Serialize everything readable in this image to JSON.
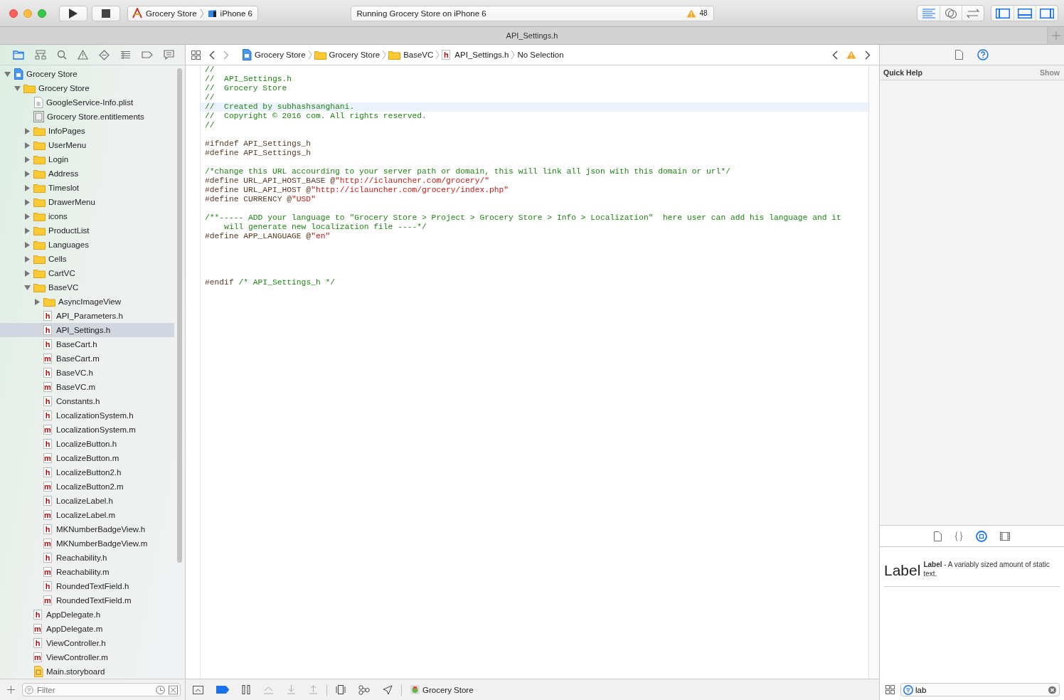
{
  "toolbar": {
    "scheme": "Grocery Store",
    "destination": "iPhone 6",
    "status": "Running Grocery Store on iPhone 6",
    "warning_count": "48",
    "editor_modes": [
      {
        "kind": "standard",
        "selected": true
      },
      {
        "kind": "assistant",
        "selected": false
      },
      {
        "kind": "version",
        "selected": false
      }
    ],
    "panels": [
      {
        "kind": "left",
        "on": true
      },
      {
        "kind": "bottom",
        "on": true
      },
      {
        "kind": "right",
        "on": true
      }
    ]
  },
  "tab_bar": {
    "title": "API_Settings.h"
  },
  "navigator": {
    "tabs": [
      {
        "kind": "project",
        "selected": true
      },
      {
        "kind": "symbol",
        "selected": false
      },
      {
        "kind": "find",
        "selected": false
      },
      {
        "kind": "issue",
        "selected": false
      },
      {
        "kind": "test",
        "selected": false
      },
      {
        "kind": "debug",
        "selected": false
      },
      {
        "kind": "breakpoint",
        "selected": false
      },
      {
        "kind": "report",
        "selected": false
      }
    ],
    "tree": [
      {
        "name": "Grocery Store",
        "kind": "project",
        "expanded": true,
        "selected": false,
        "children": [
          {
            "name": "Grocery Store",
            "kind": "folder",
            "expanded": true,
            "selected": false,
            "children": [
              {
                "name": "GoogleService-Info.plist",
                "kind": "plist",
                "selected": false
              },
              {
                "name": "Grocery Store.entitlements",
                "kind": "entitlements",
                "selected": false
              },
              {
                "name": "InfoPages",
                "kind": "folder",
                "expanded": false,
                "selected": false
              },
              {
                "name": "UserMenu",
                "kind": "folder",
                "expanded": false,
                "selected": false
              },
              {
                "name": "Login",
                "kind": "folder",
                "expanded": false,
                "selected": false
              },
              {
                "name": "Address",
                "kind": "folder",
                "expanded": false,
                "selected": false
              },
              {
                "name": "Timeslot",
                "kind": "folder",
                "expanded": false,
                "selected": false
              },
              {
                "name": "DrawerMenu",
                "kind": "folder",
                "expanded": false,
                "selected": false
              },
              {
                "name": "icons",
                "kind": "folder",
                "expanded": false,
                "selected": false
              },
              {
                "name": "ProductList",
                "kind": "folder",
                "expanded": false,
                "selected": false
              },
              {
                "name": "Languages",
                "kind": "folder",
                "expanded": false,
                "selected": false
              },
              {
                "name": "Cells",
                "kind": "folder",
                "expanded": false,
                "selected": false
              },
              {
                "name": "CartVC",
                "kind": "folder",
                "expanded": false,
                "selected": false
              },
              {
                "name": "BaseVC",
                "kind": "folder",
                "expanded": true,
                "selected": false,
                "children": [
                  {
                    "name": "AsyncImageView",
                    "kind": "folder",
                    "expanded": false,
                    "selected": false
                  },
                  {
                    "name": "API_Parameters.h",
                    "kind": "file",
                    "letter": "h",
                    "selected": false
                  },
                  {
                    "name": "API_Settings.h",
                    "kind": "file",
                    "letter": "h",
                    "selected": true
                  },
                  {
                    "name": "BaseCart.h",
                    "kind": "file",
                    "letter": "h",
                    "selected": false
                  },
                  {
                    "name": "BaseCart.m",
                    "kind": "file",
                    "letter": "m",
                    "selected": false
                  },
                  {
                    "name": "BaseVC.h",
                    "kind": "file",
                    "letter": "h",
                    "selected": false
                  },
                  {
                    "name": "BaseVC.m",
                    "kind": "file",
                    "letter": "m",
                    "selected": false
                  },
                  {
                    "name": "Constants.h",
                    "kind": "file",
                    "letter": "h",
                    "selected": false
                  },
                  {
                    "name": "LocalizationSystem.h",
                    "kind": "file",
                    "letter": "h",
                    "selected": false
                  },
                  {
                    "name": "LocalizationSystem.m",
                    "kind": "file",
                    "letter": "m",
                    "selected": false
                  },
                  {
                    "name": "LocalizeButton.h",
                    "kind": "file",
                    "letter": "h",
                    "selected": false
                  },
                  {
                    "name": "LocalizeButton.m",
                    "kind": "file",
                    "letter": "m",
                    "selected": false
                  },
                  {
                    "name": "LocalizeButton2.h",
                    "kind": "file",
                    "letter": "h",
                    "selected": false
                  },
                  {
                    "name": "LocalizeButton2.m",
                    "kind": "file",
                    "letter": "m",
                    "selected": false
                  },
                  {
                    "name": "LocalizeLabel.h",
                    "kind": "file",
                    "letter": "h",
                    "selected": false
                  },
                  {
                    "name": "LocalizeLabel.m",
                    "kind": "file",
                    "letter": "m",
                    "selected": false
                  },
                  {
                    "name": "MKNumberBadgeView.h",
                    "kind": "file",
                    "letter": "h",
                    "selected": false
                  },
                  {
                    "name": "MKNumberBadgeView.m",
                    "kind": "file",
                    "letter": "m",
                    "selected": false
                  },
                  {
                    "name": "Reachability.h",
                    "kind": "file",
                    "letter": "h",
                    "selected": false
                  },
                  {
                    "name": "Reachability.m",
                    "kind": "file",
                    "letter": "m",
                    "selected": false
                  },
                  {
                    "name": "RoundedTextField.h",
                    "kind": "file",
                    "letter": "h",
                    "selected": false
                  },
                  {
                    "name": "RoundedTextField.m",
                    "kind": "file",
                    "letter": "m",
                    "selected": false
                  }
                ]
              },
              {
                "name": "AppDelegate.h",
                "kind": "file",
                "letter": "h",
                "selected": false
              },
              {
                "name": "AppDelegate.m",
                "kind": "file",
                "letter": "m",
                "selected": false
              },
              {
                "name": "ViewController.h",
                "kind": "file",
                "letter": "h",
                "selected": false
              },
              {
                "name": "ViewController.m",
                "kind": "file",
                "letter": "m",
                "selected": false
              },
              {
                "name": "Main.storyboard",
                "kind": "storyboard",
                "selected": false
              }
            ]
          }
        ]
      }
    ],
    "filter": {
      "placeholder": "Filter"
    }
  },
  "jump_bar": {
    "path": [
      {
        "label": "Grocery Store",
        "kind": "project"
      },
      {
        "label": "Grocery Store",
        "kind": "folder"
      },
      {
        "label": "BaseVC",
        "kind": "folder"
      },
      {
        "label": "API_Settings.h",
        "kind": "file",
        "letter": "h"
      },
      {
        "label": "No Selection"
      }
    ]
  },
  "editor": {
    "lines": [
      {
        "segments": [
          {
            "kind": "comment",
            "text": "//"
          }
        ]
      },
      {
        "segments": [
          {
            "kind": "comment",
            "text": "//  API_Settings.h"
          }
        ]
      },
      {
        "segments": [
          {
            "kind": "comment",
            "text": "//  Grocery Store"
          }
        ]
      },
      {
        "segments": [
          {
            "kind": "comment",
            "text": "//"
          }
        ]
      },
      {
        "highlighted": true,
        "segments": [
          {
            "kind": "comment",
            "text": "//  Created by subhashsanghani."
          }
        ]
      },
      {
        "segments": [
          {
            "kind": "comment",
            "text": "//  Copyright © 2016 com. All rights reserved."
          }
        ]
      },
      {
        "segments": [
          {
            "kind": "comment",
            "text": "//"
          }
        ]
      },
      {
        "kind": "blank"
      },
      {
        "segments": [
          {
            "kind": "directive",
            "text": "#ifndef API_Settings_h"
          }
        ]
      },
      {
        "segments": [
          {
            "kind": "directive",
            "text": "#define API_Settings_h"
          }
        ]
      },
      {
        "kind": "blank"
      },
      {
        "segments": [
          {
            "kind": "comment",
            "text": "/*change this URL accourding to your server path or domain, this will link all json with this domain or url*/"
          }
        ]
      },
      {
        "segments": [
          {
            "kind": "directive",
            "text": "#define URL_API_HOST_BASE @"
          },
          {
            "kind": "string",
            "text": "\"http://iclauncher.com/grocery/\""
          }
        ]
      },
      {
        "segments": [
          {
            "kind": "directive",
            "text": "#define URL_API_HOST @"
          },
          {
            "kind": "string",
            "text": "\"http://iclauncher.com/grocery/index.php\""
          }
        ]
      },
      {
        "segments": [
          {
            "kind": "directive",
            "text": "#define CURRENCY @"
          },
          {
            "kind": "string",
            "text": "\"USD\""
          }
        ]
      },
      {
        "kind": "blank"
      },
      {
        "segments": [
          {
            "kind": "comment",
            "text": "/**----- ADD your language to \"Grocery Store > Project > Grocery Store > Info > Localization\"  here user can add his language and it"
          }
        ]
      },
      {
        "segments": [
          {
            "kind": "comment",
            "text": "    will generate new localization file ----*/"
          }
        ]
      },
      {
        "segments": [
          {
            "kind": "directive",
            "text": "#define APP_LANGUAGE @"
          },
          {
            "kind": "string",
            "text": "\"en\""
          }
        ]
      },
      {
        "kind": "blank"
      },
      {
        "kind": "blank"
      },
      {
        "kind": "blank"
      },
      {
        "kind": "blank"
      },
      {
        "segments": [
          {
            "kind": "directive",
            "text": "#endif "
          },
          {
            "kind": "comment",
            "text": "/* API_Settings_h */"
          }
        ]
      }
    ]
  },
  "debug_bar": {
    "breakpoints_on": true,
    "target": "Grocery Store"
  },
  "inspector": {
    "tabs": [
      {
        "kind": "file",
        "selected": false
      },
      {
        "kind": "help",
        "selected": true
      }
    ],
    "title": "Quick Help",
    "action": "Show",
    "library_tabs": [
      {
        "kind": "file",
        "selected": false
      },
      {
        "kind": "code",
        "selected": false
      },
      {
        "kind": "object",
        "selected": true
      },
      {
        "kind": "media",
        "selected": false
      }
    ],
    "library_items": [
      {
        "preview": "Label",
        "description": "**Label** - A variably sized amount of static text."
      }
    ],
    "search": {
      "value": "lab"
    }
  }
}
